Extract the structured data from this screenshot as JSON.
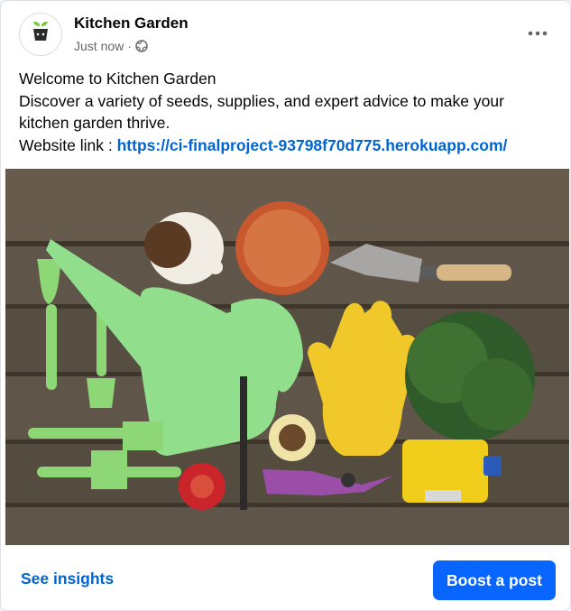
{
  "post": {
    "page_name": "Kitchen Garden",
    "timestamp": "Just now",
    "separator": "·",
    "audience_icon": "globe-icon",
    "more_icon": "more-horizontal-icon",
    "avatar_icon": "garden-logo-icon",
    "text_line1": "Welcome to Kitchen Garden",
    "text_line2": "Discover a variety of seeds, supplies, and expert advice to make your",
    "text_line3": "kitchen garden thrive.",
    "website_label": "Website link : ",
    "website_url": "https://ci-finalproject-93798f70d775.herokuapp.com/",
    "image_description_icon": "garden-tools-photo"
  },
  "footer": {
    "insights_label": "See insights",
    "boost_label": "Boost a post"
  },
  "colors": {
    "link": "#0064d1",
    "boost_button": "#0866ff",
    "secondary_text": "#65676b"
  }
}
